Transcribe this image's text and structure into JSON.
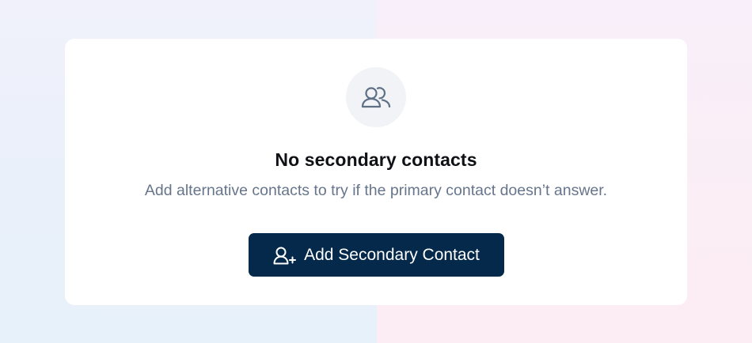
{
  "empty_state": {
    "icon": "users-icon",
    "title": "No secondary contacts",
    "description": "Add alternative contacts to try if the primary contact doesn’t answer.",
    "button": {
      "icon": "user-plus-icon",
      "label": "Add Secondary Contact"
    }
  },
  "colors": {
    "button_bg": "#04294a",
    "icon_circle_bg": "#f1f3f7",
    "icon_stroke": "#5f6f86",
    "description_text": "#66758c"
  }
}
